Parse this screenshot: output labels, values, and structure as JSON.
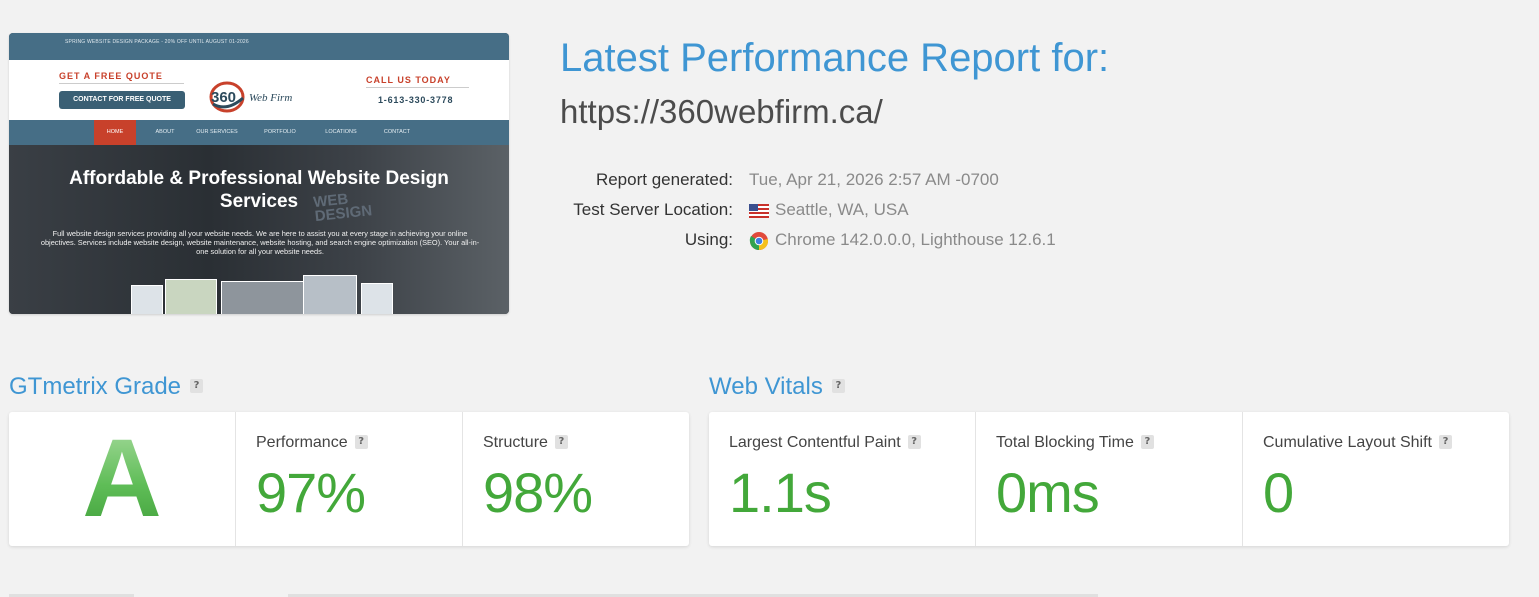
{
  "thumbnail": {
    "promo_text": "SPRING WEBSITE DESIGN PACKAGE - 20% OFF UNTIL AUGUST 01-2026",
    "quote_title": "GET A FREE QUOTE",
    "quote_button": "CONTACT FOR FREE QUOTE",
    "logo_number": "360",
    "logo_text": "Web Firm",
    "call_title": "CALL US TODAY",
    "phone": "1-613-330-3778",
    "nav": [
      "HOME",
      "ABOUT",
      "OUR SERVICES",
      "PORTFOLIO",
      "LOCATIONS",
      "CONTACT"
    ],
    "hero_bg_word": "WEB DESIGN",
    "hero_title": "Affordable & Professional Website Design Services",
    "hero_text": "Full website design services providing all your website needs. We are here to assist you at every stage in achieving your online objectives. Services include website design, website maintenance, website hosting, and search engine optimization (SEO). Your all-in-one solution for all your website needs."
  },
  "report": {
    "title": "Latest Performance Report for:",
    "url": "https://360webfirm.ca/",
    "generated_label": "Report generated:",
    "generated_value": "Tue, Apr 21, 2026 2:57 AM -0700",
    "location_label": "Test Server Location:",
    "location_value": "Seattle, WA, USA",
    "using_label": "Using:",
    "using_value": "Chrome 142.0.0.0, Lighthouse 12.6.1"
  },
  "grade_section": {
    "title": "GTmetrix Grade",
    "help": "?",
    "grade": "A",
    "performance_label": "Performance",
    "performance_value": "97%",
    "structure_label": "Structure",
    "structure_value": "98%"
  },
  "vitals_section": {
    "title": "Web Vitals",
    "help": "?",
    "lcp_label": "Largest Contentful Paint",
    "lcp_value": "1.1s",
    "tbt_label": "Total Blocking Time",
    "tbt_value": "0ms",
    "cls_label": "Cumulative Layout Shift",
    "cls_value": "0"
  },
  "colors": {
    "title_blue": "#3f96d3",
    "good_green": "#43a83a",
    "page_bg": "#f2f2f2"
  },
  "icons": {
    "location": "us-flag-icon",
    "browser": "chrome-icon",
    "help": "help-icon"
  }
}
